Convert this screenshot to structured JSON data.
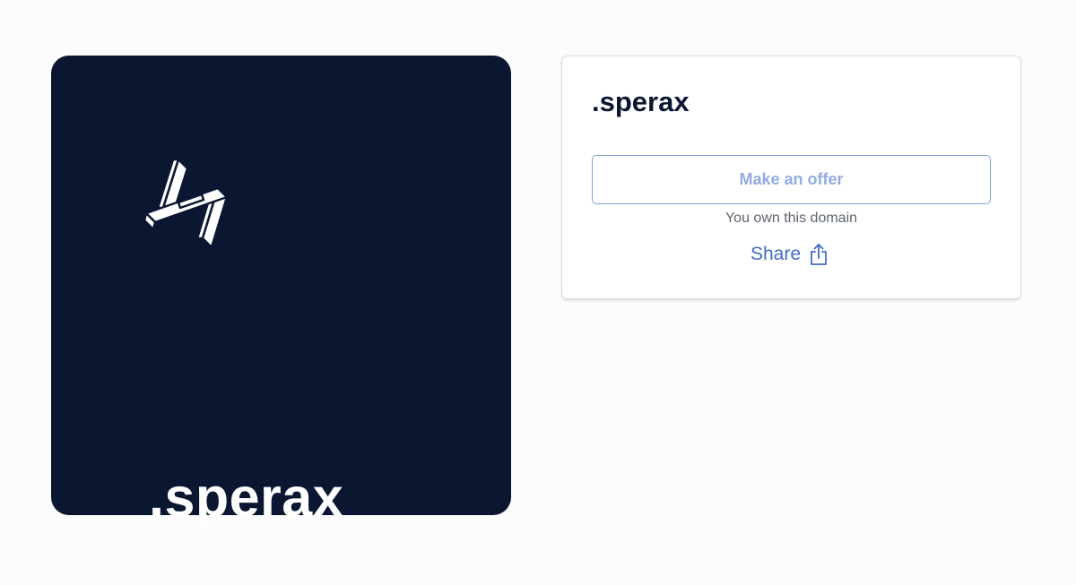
{
  "card": {
    "domain_name": ".sperax",
    "logo_icon": "sperax-logo-icon",
    "background_color": "#0b1631"
  },
  "panel": {
    "title": ".sperax",
    "offer_button_label": "Make an offer",
    "owner_note": "You own this domain",
    "share_label": "Share",
    "share_icon": "share-icon",
    "accent_color": "#3f6cc4"
  }
}
